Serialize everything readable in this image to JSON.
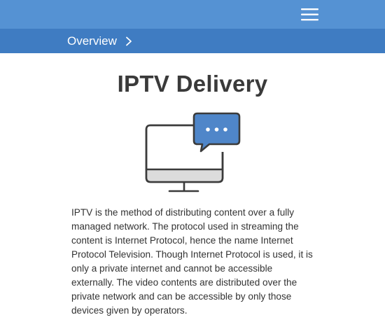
{
  "header": {
    "menu_icon": "hamburger-menu-icon"
  },
  "breadcrumb": {
    "label": "Overview",
    "chevron_icon": "chevron-right-icon"
  },
  "main": {
    "title": "IPTV Delivery",
    "illustration_icon": "monitor-chat-bubble-icon",
    "description": "IPTV is the method of distributing content over a fully managed network. The protocol used in streaming the content is Internet Protocol, hence the name Internet Protocol Television. Though Internet Protocol is used, it is only a private internet and cannot be accessible externally. The video contents are distributed over the private network and can be accessible by only those devices given by operators."
  },
  "colors": {
    "header_bg": "#5592d3",
    "subheader_bg": "#3f7cc2",
    "accent": "#4f86c9",
    "text": "#333333"
  }
}
